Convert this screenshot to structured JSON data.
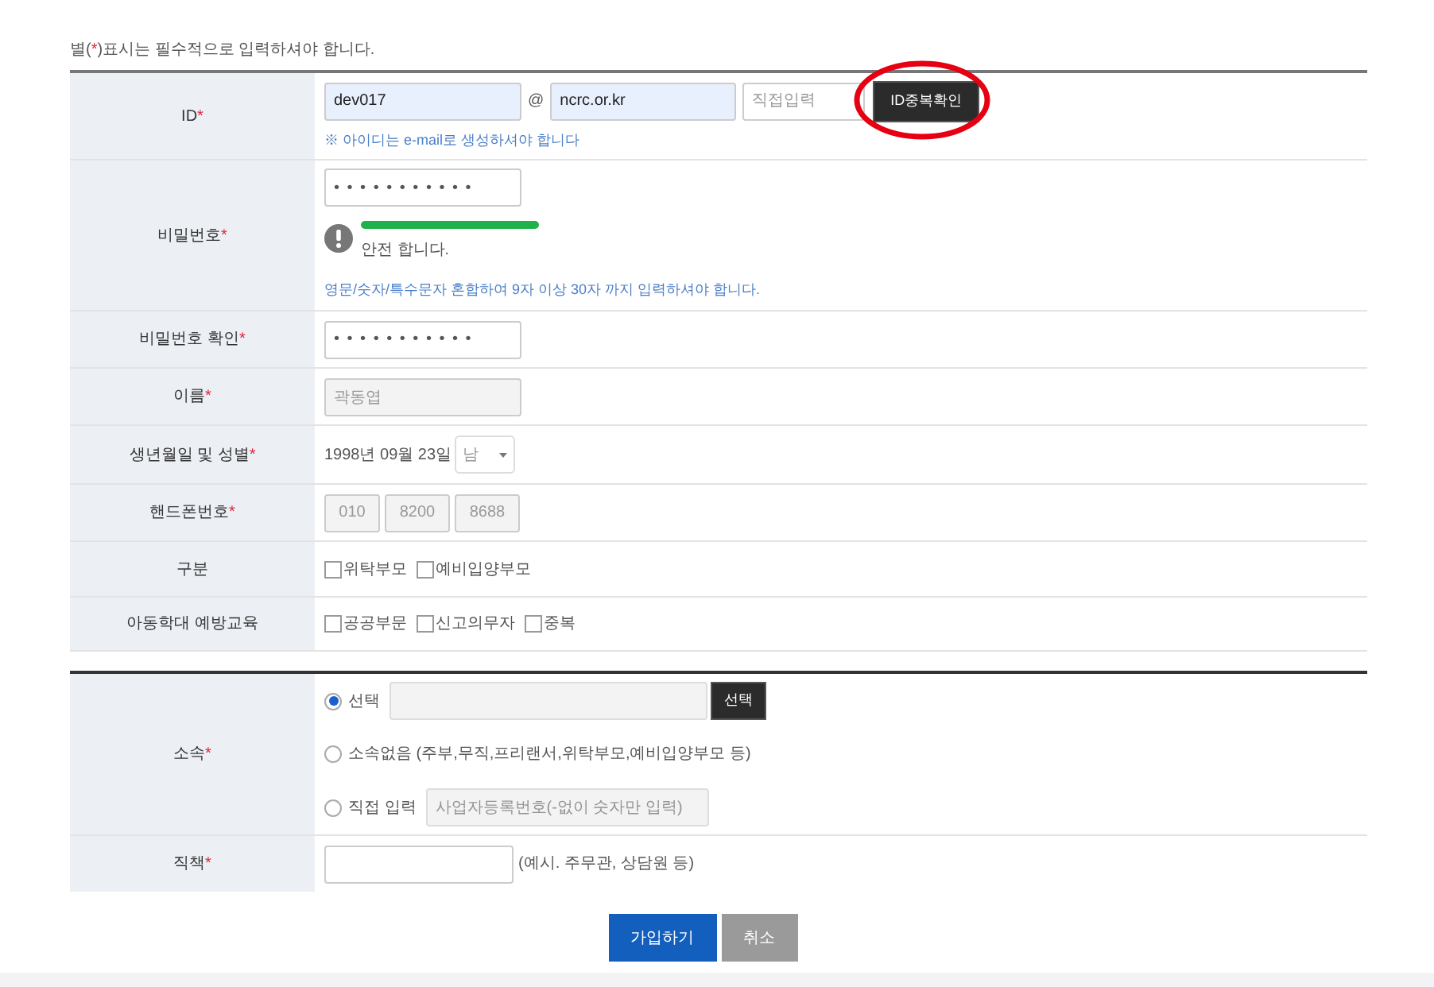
{
  "notice": {
    "before": "별(",
    "mark": "*",
    "after": ")표시는 필수적으로 입력하셔야 합니다."
  },
  "rows": [
    {
      "kind": "id",
      "label": "ID",
      "required_mark": "*",
      "id_value": "dev017",
      "at": "@",
      "domain": "ncrc.or.kr",
      "domain_placeholder": "직접입력",
      "check_button": "ID중복확인",
      "hint": "※ 아이디는 e-mail로 생성하셔야 합니다",
      "highlighted": true
    },
    {
      "kind": "password",
      "label": "비밀번호",
      "required_mark": "*",
      "value": "• • • • • • • • • • •",
      "strength": {
        "message": "안전 합니다."
      },
      "hint": "영문/숫자/특수문자 혼합하여 9자 이상 30자 까지 입력하셔야 합니다."
    },
    {
      "kind": "text",
      "label": "비밀번호 확인",
      "required_mark": "*",
      "value": "• • • • • • • • • • •",
      "disabled": false
    },
    {
      "kind": "text",
      "label": "이름",
      "required_mark": "*",
      "value": "곽동엽",
      "disabled": true
    },
    {
      "kind": "birth",
      "label": "생년월일 및 성별",
      "required_mark": "*",
      "birth": "1998년 09월 23일",
      "gender": "남"
    },
    {
      "kind": "phone",
      "label": "핸드폰번호",
      "required_mark": "*",
      "parts": [
        "010",
        "8200",
        "8688"
      ]
    },
    {
      "kind": "checks",
      "label": "구분",
      "options": [
        {
          "label": "위탁부모",
          "checked": false
        },
        {
          "label": "예비입양부모",
          "checked": false
        }
      ]
    },
    {
      "kind": "checks",
      "label": "아동학대 예방교육",
      "options": [
        {
          "label": "공공부문",
          "checked": false
        },
        {
          "label": "신고의무자",
          "checked": false
        },
        {
          "label": "중복",
          "checked": false
        }
      ]
    }
  ],
  "affiliation": {
    "label": "소속",
    "required_mark": "*",
    "options": [
      {
        "kind": "search",
        "label": "선택",
        "selected": true,
        "button": "선택"
      },
      {
        "kind": "plain",
        "label": "소속없음 (주부,무직,프리랜서,위탁부모,예비입양부모 등)",
        "selected": false
      },
      {
        "kind": "input",
        "label": "직접 입력",
        "selected": false,
        "placeholder": "사업자등록번호(-없이 숫자만 입력)"
      }
    ]
  },
  "position": {
    "label": "직책",
    "required_mark": "*",
    "example": "(예시. 주무관, 상담원 등)"
  },
  "buttons": [
    {
      "kind": "primary",
      "label": "가입하기"
    },
    {
      "kind": "secondary",
      "label": "취소"
    }
  ]
}
